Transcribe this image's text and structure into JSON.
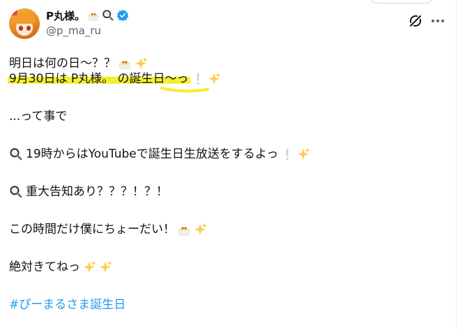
{
  "author": {
    "display_name": "P丸様。",
    "handle": "@p_ma_ru",
    "name_icons": [
      "chick-icon",
      "magnifier-icon",
      "verified-badge-icon"
    ]
  },
  "toolbar": {
    "grok_icon": "grok-icon",
    "more_icon": "more-icon"
  },
  "colors": {
    "highlight": "#f4ee2e",
    "hashtag": "#1d9bf0",
    "verified": "#1d9bf0",
    "handle": "#536471"
  },
  "tweet": {
    "line1": "明日は何の日～？？",
    "line2": "9月30日は P丸様。 の誕生日～っ",
    "line3": "...って事で",
    "line4": "19時からはYouTubeで誕生日生放送をするよっ",
    "line5": "重大告知あり？？？！？！",
    "line6": "この時間だけ僕にちょーだい！",
    "line7": "絶対きてねっ",
    "hashtag": "#ぴーまるさま誕生日"
  }
}
